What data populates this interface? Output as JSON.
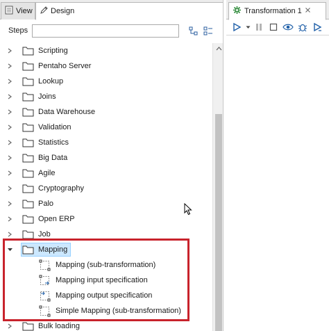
{
  "left_tabs": {
    "view_label": "View",
    "design_label": "Design"
  },
  "steps": {
    "label": "Steps",
    "search_value": ""
  },
  "tree": {
    "categories": [
      "Scripting",
      "Pentaho Server",
      "Lookup",
      "Joins",
      "Data Warehouse",
      "Validation",
      "Statistics",
      "Big Data",
      "Agile",
      "Cryptography",
      "Palo",
      "Open ERP",
      "Job"
    ],
    "expanded": {
      "label": "Mapping",
      "children": [
        "Mapping (sub-transformation)",
        "Mapping input specification",
        "Mapping output specification",
        "Simple Mapping (sub-transformation)"
      ]
    },
    "after": [
      "Bulk loading"
    ]
  },
  "right_tab": {
    "title": "Transformation 1"
  },
  "colors": {
    "highlight": "#c8232c",
    "selection": "#cce8ff",
    "folder_stroke": "#333333",
    "accent": "#1f5fa8"
  },
  "icons": [
    "view-icon",
    "design-icon",
    "collapse-all-icon",
    "expand-all-icon",
    "folder-icon",
    "chevron-right-icon",
    "chevron-down-icon",
    "mapping-step-icon",
    "transformation-icon",
    "close-icon",
    "run-icon",
    "pause-icon",
    "stop-icon",
    "preview-icon",
    "debug-icon",
    "replay-icon"
  ]
}
